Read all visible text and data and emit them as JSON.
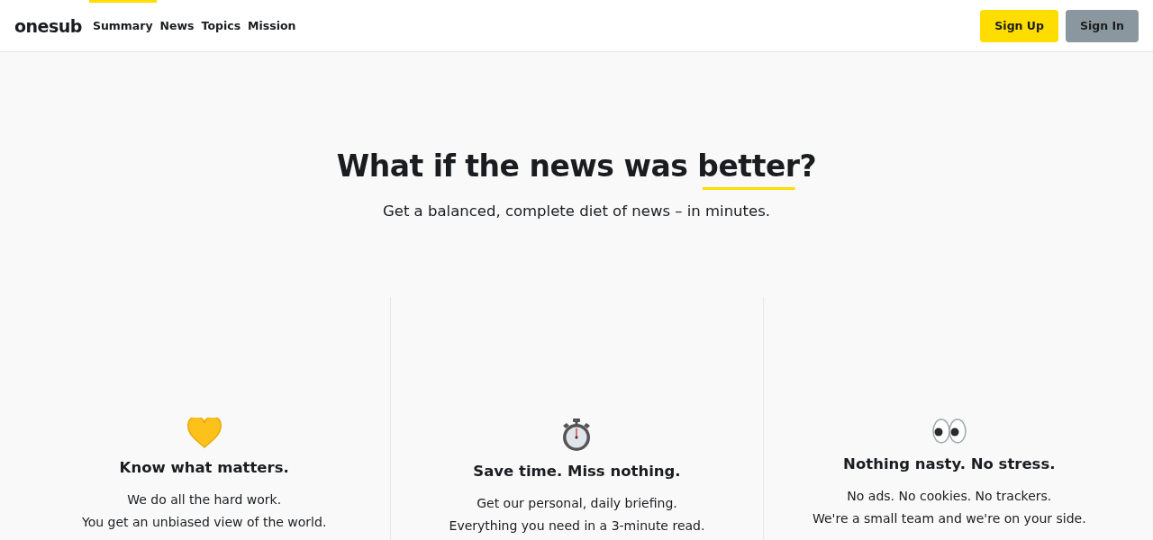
{
  "nav": {
    "logo": "onesub",
    "links": [
      {
        "label": "Summary",
        "selected": true
      },
      {
        "label": "News",
        "selected": false
      },
      {
        "label": "Topics",
        "selected": false
      },
      {
        "label": "Mission",
        "selected": false
      }
    ],
    "buttons": [
      {
        "label": "Sign Up",
        "kind": "primary"
      },
      {
        "label": "Sign In",
        "kind": "secondary"
      }
    ]
  },
  "hero": {
    "heading": {
      "before": "What if the news was ",
      "highlight": "better",
      "after": "?"
    },
    "subheading": "Get a balanced, complete diet of news – in minutes."
  },
  "features": [
    {
      "title": "Know what matters.",
      "lines": [
        "We do all the hard work.",
        "You get an unbiased view of the world."
      ]
    },
    {
      "title": "Save time. Miss nothing.",
      "lines": [
        "Get our personal, daily briefing.",
        "Everything you need in a 3-minute read."
      ]
    },
    {
      "title": "Nothing nasty. No stress.",
      "lines": [
        "No ads. No cookies. No trackers.",
        "We're a small team and we're on your side."
      ]
    }
  ]
}
